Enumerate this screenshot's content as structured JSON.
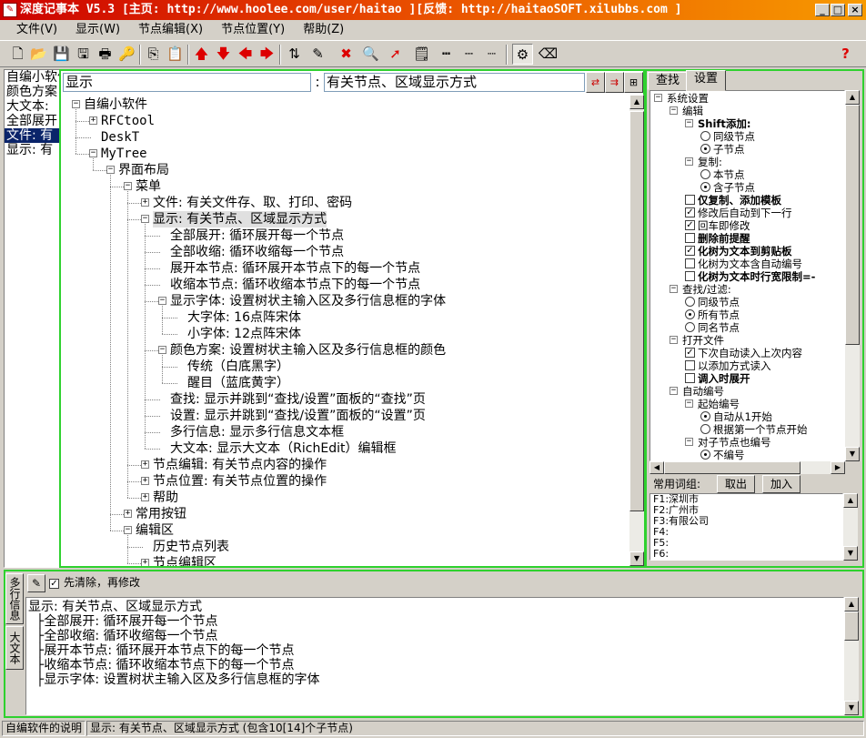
{
  "window": {
    "title": "深度记事本 V5.3 [主页: http://www.hoolee.com/user/haitao ][反馈: http://haitaoSOFT.xilubbs.com ]",
    "min_label": "_",
    "max_label": "□",
    "close_label": "×"
  },
  "menu": [
    "文件(V)",
    "显示(W)",
    "节点编辑(X)",
    "节点位置(Y)",
    "帮助(Z)"
  ],
  "toolbar": {
    "icons": [
      "new-file-icon",
      "open-folder-icon",
      "save-icon",
      "save-as-icon",
      "print-icon",
      "find-key-icon",
      "copy-node-icon",
      "paste-node-icon",
      "move-up-icon",
      "move-down-icon",
      "move-left-icon",
      "move-right-icon",
      "sort-icon",
      "edit-pencil-icon",
      "delete-icon",
      "zoom-icon",
      "cursor-icon",
      "note-icon",
      "line-style-1-icon",
      "line-style-2-icon",
      "line-style-3-icon",
      "tree-settings-icon",
      "eraser-icon",
      "help-icon"
    ],
    "help_label": "?"
  },
  "history": [
    {
      "text": "自编小软件",
      "selected": false
    },
    {
      "text": "颜色方案",
      "selected": false
    },
    {
      "text": "大文本:",
      "selected": false
    },
    {
      "text": "全部展开",
      "selected": false
    },
    {
      "text": "文件: 有",
      "selected": true
    },
    {
      "text": "显示: 有",
      "selected": false
    }
  ],
  "search": {
    "value": "显示",
    "colon": ":",
    "node_title": "有关节点、区域显示方式"
  },
  "tree": {
    "nodes": [
      {
        "text": "自编小软件",
        "level": 0,
        "exp": "−"
      },
      {
        "text": "RFCtool",
        "level": 1,
        "exp": "+"
      },
      {
        "text": "DeskT",
        "level": 1,
        "exp": ""
      },
      {
        "text": "MyTree",
        "level": 1,
        "exp": "−"
      },
      {
        "text": "界面布局",
        "level": 2,
        "exp": "−"
      },
      {
        "text": "菜单",
        "level": 3,
        "exp": "−"
      },
      {
        "text": "文件: 有关文件存、取、打印、密码",
        "level": 4,
        "exp": "+"
      },
      {
        "text": "显示: 有关节点、区域显示方式",
        "level": 4,
        "exp": "−",
        "highlight": true
      },
      {
        "text": "全部展开: 循环展开每一个节点",
        "level": 5,
        "exp": ""
      },
      {
        "text": "全部收缩: 循环收缩每一个节点",
        "level": 5,
        "exp": ""
      },
      {
        "text": "展开本节点: 循环展开本节点下的每一个节点",
        "level": 5,
        "exp": ""
      },
      {
        "text": "收缩本节点: 循环收缩本节点下的每一个节点",
        "level": 5,
        "exp": ""
      },
      {
        "text": "显示字体: 设置树状主输入区及多行信息框的字体",
        "level": 5,
        "exp": "−"
      },
      {
        "text": "大字体: 16点阵宋体",
        "level": 6,
        "exp": ""
      },
      {
        "text": "小字体: 12点阵宋体",
        "level": 6,
        "exp": ""
      },
      {
        "text": "颜色方案: 设置树状主输入区及多行信息框的颜色",
        "level": 5,
        "exp": "−"
      },
      {
        "text": "传统（白底黑字）",
        "level": 6,
        "exp": ""
      },
      {
        "text": "醒目（蓝底黄字）",
        "level": 6,
        "exp": ""
      },
      {
        "text": "查找: 显示并跳到“查找/设置”面板的“查找”页",
        "level": 5,
        "exp": ""
      },
      {
        "text": "设置: 显示并跳到“查找/设置”面板的“设置”页",
        "level": 5,
        "exp": ""
      },
      {
        "text": "多行信息: 显示多行信息文本框",
        "level": 5,
        "exp": ""
      },
      {
        "text": "大文本: 显示大文本（RichEdit）编辑框",
        "level": 5,
        "exp": ""
      },
      {
        "text": "节点编辑: 有关节点内容的操作",
        "level": 4,
        "exp": "+"
      },
      {
        "text": "节点位置: 有关节点位置的操作",
        "level": 4,
        "exp": "+"
      },
      {
        "text": "帮助",
        "level": 4,
        "exp": "+"
      },
      {
        "text": "常用按钮",
        "level": 3,
        "exp": "+"
      },
      {
        "text": "编辑区",
        "level": 3,
        "exp": "−"
      },
      {
        "text": "历史节点列表",
        "level": 4,
        "exp": ""
      },
      {
        "text": "节点编辑区",
        "level": 4,
        "exp": "+"
      }
    ]
  },
  "tabs": {
    "search": "查找",
    "settings": "设置"
  },
  "settings": [
    {
      "text": "系统设置",
      "level": 0,
      "kind": "exp"
    },
    {
      "text": "编辑",
      "level": 1,
      "kind": "exp"
    },
    {
      "text": "Shift添加:",
      "level": 2,
      "kind": "exp",
      "bold": true
    },
    {
      "text": "同级节点",
      "level": 3,
      "kind": "radio",
      "on": false
    },
    {
      "text": "子节点",
      "level": 3,
      "kind": "radio",
      "on": true
    },
    {
      "text": "复制:",
      "level": 2,
      "kind": "exp"
    },
    {
      "text": "本节点",
      "level": 3,
      "kind": "radio",
      "on": false
    },
    {
      "text": "含子节点",
      "level": 3,
      "kind": "radio",
      "on": true
    },
    {
      "text": "仅复制、添加模板",
      "level": 2,
      "kind": "check",
      "on": false,
      "bold": true
    },
    {
      "text": "修改后自动到下一行",
      "level": 2,
      "kind": "check",
      "on": true
    },
    {
      "text": "回车即修改",
      "level": 2,
      "kind": "check",
      "on": true
    },
    {
      "text": "删除前提醒",
      "level": 2,
      "kind": "check",
      "on": false,
      "bold": true
    },
    {
      "text": "化树为文本到剪贴板",
      "level": 2,
      "kind": "check",
      "on": true,
      "bold": true
    },
    {
      "text": "化树为文本含自动编号",
      "level": 2,
      "kind": "check",
      "on": false
    },
    {
      "text": "化树为文本时行宽限制=-",
      "level": 2,
      "kind": "check",
      "on": false,
      "bold": true
    },
    {
      "text": "查找/过滤:",
      "level": 1,
      "kind": "exp"
    },
    {
      "text": "同级节点",
      "level": 2,
      "kind": "radio",
      "on": false
    },
    {
      "text": "所有节点",
      "level": 2,
      "kind": "radio",
      "on": true
    },
    {
      "text": "同名节点",
      "level": 2,
      "kind": "radio",
      "on": false
    },
    {
      "text": "打开文件",
      "level": 1,
      "kind": "exp"
    },
    {
      "text": "下次自动读入上次内容",
      "level": 2,
      "kind": "check",
      "on": true
    },
    {
      "text": "以添加方式读入",
      "level": 2,
      "kind": "check",
      "on": false
    },
    {
      "text": "调入时展开",
      "level": 2,
      "kind": "check",
      "on": false,
      "bold": true
    },
    {
      "text": "自动编号",
      "level": 1,
      "kind": "exp"
    },
    {
      "text": "起始编号",
      "level": 2,
      "kind": "exp"
    },
    {
      "text": "自动从1开始",
      "level": 3,
      "kind": "radio",
      "on": true
    },
    {
      "text": "根据第一个节点开始",
      "level": 3,
      "kind": "radio",
      "on": false
    },
    {
      "text": "对子节点也编号",
      "level": 2,
      "kind": "exp"
    },
    {
      "text": "不编号",
      "level": 3,
      "kind": "radio",
      "on": true
    }
  ],
  "phrases": {
    "label": "常用词组:",
    "take_label": "取出",
    "add_label": "加入",
    "items": [
      "F1:深圳市",
      "F2:广州市",
      "F3:有限公司",
      "F4:",
      "F5:",
      "F6:"
    ]
  },
  "bottom": {
    "tab_multiline": "多行信息",
    "tab_bigtext": "大文本",
    "clear_first_label": "先清除，再修改",
    "clear_first_checked": true,
    "detail_lines": [
      "显示: 有关节点、区域显示方式",
      "  ├全部展开: 循环展开每一个节点",
      "  ├全部收缩: 循环收缩每一个节点",
      "  ├展开本节点: 循环展开本节点下的每一个节点",
      "  ├收缩本节点: 循环收缩本节点下的每一个节点",
      "  ├显示字体: 设置树状主输入区及多行信息框的字体"
    ]
  },
  "status": {
    "left": "自编软件的说明",
    "right": "显示: 有关节点、区域显示方式 (包含10[14]个子节点)"
  }
}
